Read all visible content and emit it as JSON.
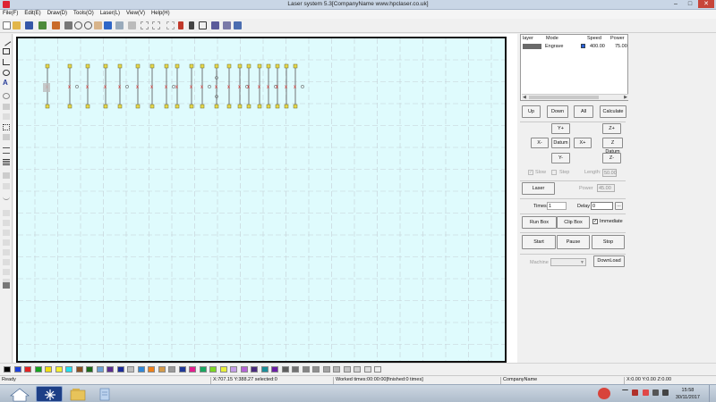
{
  "window": {
    "title": "Laser system 5.3[CompanyName www.hpclaser.co.uk]",
    "min": "–",
    "max": "□",
    "close": "✕"
  },
  "menu": [
    "File(F)",
    "Edit(E)",
    "Draw(D)",
    "Tools(O)",
    "Laser(L)",
    "View(V)",
    "Help(H)"
  ],
  "toolbar_icons": [
    "new-file-icon",
    "open-folder-icon",
    "save-icon",
    "import-icon",
    "export-icon",
    "cut-icon",
    "zoom-in-icon",
    "zoom-out-icon",
    "pan-hand-icon",
    "zoom-fit-icon",
    "undo-icon",
    "redo-icon",
    "group-icon",
    "ungroup-icon",
    "snap-icon",
    "node-edit-icon",
    "array-icon",
    "settings-icon",
    "gear-icon"
  ],
  "left_tools": [
    "line-tool-icon",
    "rectangle-tool-icon",
    "polyline-tool-icon",
    "ellipse-tool-icon",
    "text-tool-icon",
    "rotate-tool-icon",
    "mirror-tool-icon",
    "array-tool-icon",
    "node-tool-icon",
    "scale-tool-icon",
    "align-icon",
    "distribute-icon",
    "fill-tool-icon",
    "offset-tool-icon",
    "curve-tool-icon",
    "align-left-icon",
    "align-right-icon",
    "align-top-icon",
    "align-bottom-icon",
    "center-h-icon",
    "center-v-icon",
    "same-width-icon",
    "same-height-icon",
    "layers-tool-icon"
  ],
  "layers": {
    "headers": [
      "layer",
      "Mode",
      "Speed",
      "Power"
    ],
    "rows": [
      {
        "color": "#6a6a6a",
        "mode": "Engrave",
        "speed": "400.00",
        "power": "75.00"
      }
    ]
  },
  "controls": {
    "up": "Up",
    "down": "Down",
    "all": "All",
    "calculate": "Calculate",
    "y_plus": "Y+",
    "z_plus": "Z+",
    "x_minus": "X-",
    "datum": "Datum",
    "x_plus": "X+",
    "z_datum": "Z Datum",
    "y_minus": "Y-",
    "z_minus": "Z-",
    "slow": "Slow",
    "step": "Step",
    "length_label": "Length:",
    "length_value": "50.00",
    "laser": "Laser",
    "power_label": "Power",
    "power_value": "45.00",
    "times_label": "Times",
    "times_value": "1",
    "delay_label": "Delay",
    "delay_value": "0",
    "delay_more": "...",
    "run_box": "Run Box",
    "clip_box": "Clip Box",
    "immediate": "Immediate",
    "start": "Start",
    "pause": "Pause",
    "stop": "Stop",
    "machine_label": "Machine",
    "download": "DownLoad"
  },
  "palette": [
    "#000000",
    "#1a3fd9",
    "#e52222",
    "#14a41e",
    "#f2df11",
    "#f5ef2e",
    "#23e0f0",
    "#8a4f21",
    "#1c6b1b",
    "#6aa0d6",
    "#5a2b91",
    "#1b2a9a",
    "#bdbdbd",
    "#2f87d9",
    "#f08018",
    "#d49a49",
    "#9a9a9a",
    "#1f3a9a",
    "#e51e8f",
    "#19a860",
    "#7cd826",
    "#e8f03a",
    "#c49ee8",
    "#b463d6",
    "#4a2b7d",
    "#1b8f9a",
    "#6b1fa6",
    "#5e5e5e",
    "#727272",
    "#858585",
    "#909090",
    "#a3a3a3",
    "#b5b5b5",
    "#c4c4c4",
    "#d1d1d1",
    "#dedede",
    "#ececec"
  ],
  "status": {
    "ready": "Ready",
    "coords": "X:707.15 Y:388.27 selected:0",
    "worked": "Worked times:00:00:00[finished:0 times]",
    "company": "CompanyName",
    "xyz": "X:0.00 Y:0.00 Z:0.00"
  },
  "taskbar": {
    "apps": [
      "start-orb-icon",
      "laser-app-icon",
      "file-explorer-icon",
      "notepad-icon"
    ],
    "time": "15:58",
    "date": "30/11/2017"
  }
}
